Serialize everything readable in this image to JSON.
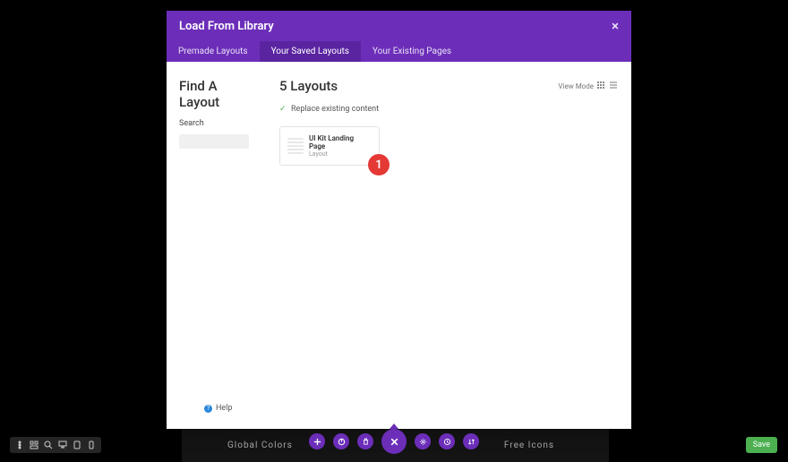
{
  "modal": {
    "title": "Load From Library",
    "tabs": [
      {
        "label": "Premade Layouts"
      },
      {
        "label": "Your Saved Layouts"
      },
      {
        "label": "Your Existing Pages"
      }
    ],
    "sidebar": {
      "title": "Find A Layout",
      "search_label": "Search"
    },
    "main": {
      "title": "5 Layouts",
      "view_mode_label": "View Mode",
      "replace_label": "Replace existing content",
      "layout": {
        "name": "UI Kit Landing Page",
        "type": "Layout"
      },
      "badge": "1"
    },
    "help_label": "Help"
  },
  "footer": {
    "left": "Global Colors",
    "right": "Free Icons"
  },
  "save_label": "Save"
}
